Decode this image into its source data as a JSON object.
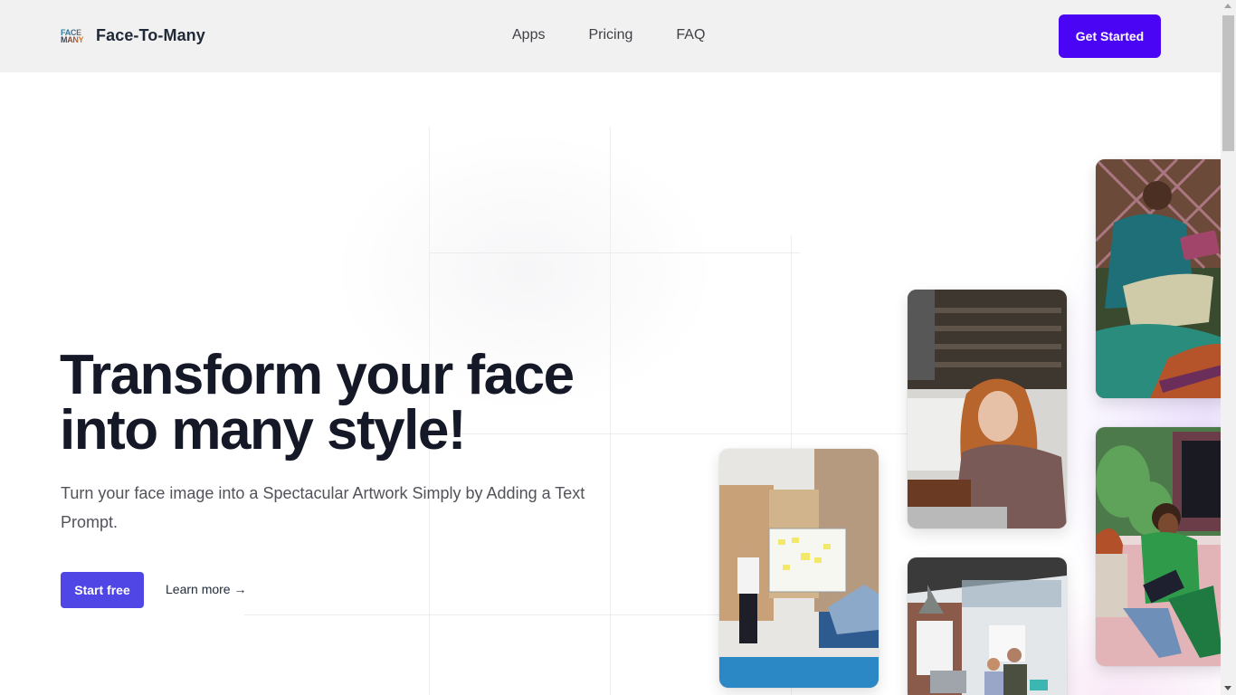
{
  "header": {
    "logo_mark_line1": "FACE",
    "logo_mark_line2": "MANY",
    "brand": "Face-To-Many",
    "nav": [
      {
        "label": "Apps"
      },
      {
        "label": "Pricing"
      },
      {
        "label": "FAQ"
      }
    ],
    "cta_label": "Get Started"
  },
  "hero": {
    "title_line1": "Transform your face",
    "title_line2": "into many style!",
    "subtitle": "Turn your face image into a Spectacular Artwork Simply by Adding a Text Prompt.",
    "primary_button": "Start free",
    "secondary_link": "Learn more →"
  },
  "gallery": [
    {
      "name": "man-laughing-with-tablet-photo",
      "description": "Man in teal sweater laughing with a tablet on a green couch"
    },
    {
      "name": "woman-with-laptop-photo",
      "description": "Red-haired woman smiling at a laptop in a cafe"
    },
    {
      "name": "whiteboard-meeting-photo",
      "description": "Man presenting at a whiteboard with sticky notes in a brick office"
    },
    {
      "name": "office-team-photo",
      "description": "Team working at computers in a loft office"
    },
    {
      "name": "women-on-pink-couch-photo",
      "description": "Two women laughing on a pink couch with a laptop"
    }
  ],
  "colors": {
    "cta_top": "#4a05f5",
    "start_button": "#4f46e5",
    "header_bg": "#f1f1f1",
    "title": "#141827"
  }
}
